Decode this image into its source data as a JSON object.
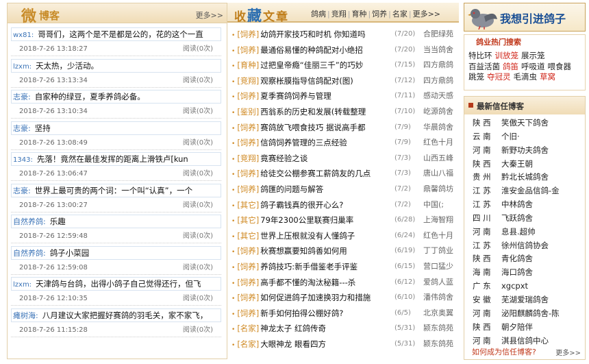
{
  "weibo": {
    "title_big": "微",
    "title_rest": "博客",
    "more": "更多>>",
    "items": [
      {
        "user": "wx81:",
        "text": "哥哥们，这两个是不是都是公的，花的这个一直",
        "time": "2018-7-26 13:18:27",
        "read": "阅读(0次)"
      },
      {
        "user": "lzxm:",
        "text": "天太热，少活动。",
        "time": "2018-7-26 13:13:34",
        "read": "阅读(0次)"
      },
      {
        "user": "志豪:",
        "text": "自家种的绿豆，夏季养鸽必备。",
        "time": "2018-7-26 13:10:34",
        "read": "阅读(0次)"
      },
      {
        "user": "志豪:",
        "text": "坚持",
        "time": "2018-7-26 13:08:49",
        "read": "阅读(0次)"
      },
      {
        "user": "1343:",
        "text": "先落！竟然在最佳发挥的距离上滑铁卢[kun",
        "time": "2018-7-26 13:06:47",
        "read": "阅读(0次)"
      },
      {
        "user": "志豪:",
        "text": "世界上最可贵的两个词：一个叫“认真”，一个",
        "time": "2018-7-26 13:00:27",
        "read": "阅读(0次)"
      },
      {
        "user": "自然养鸽:",
        "text": "乐趣",
        "time": "2018-7-26 12:59:48",
        "read": "阅读(0次)"
      },
      {
        "user": "自然养鸽:",
        "text": "鸽子小菜园",
        "time": "2018-7-26 12:59:08",
        "read": "阅读(0次)"
      },
      {
        "user": "lzxm:",
        "text": "天津鸽与台鸽，出得小鸽子自己觉得还行，但飞",
        "time": "2018-7-26 12:10:35",
        "read": "阅读(0次)"
      },
      {
        "user": "瘫树海:",
        "text": "八月建议大家把握好赛鸽的羽毛关，家不家飞，",
        "time": "2018-7-26 11:15:28",
        "read": "阅读(0次)"
      }
    ]
  },
  "collect": {
    "title_a": "收",
    "title_b": "藏",
    "title_c": "文章",
    "tabs": [
      "鸽病",
      "竞翔",
      "育种",
      "饲养",
      "名家",
      "更多>>"
    ],
    "items": [
      {
        "cat": "[饲养]",
        "title": "幼鸽开家技巧和时机 你知道吗",
        "date": "(7/20)",
        "src": "合肥绿苑"
      },
      {
        "cat": "[饲养]",
        "title": "最通俗易懂的种鸽配对小绝招",
        "date": "(7/20)",
        "src": "当当鸽舍"
      },
      {
        "cat": "[育种]",
        "title": "过把皇帝瘾“佳丽三千”的巧妙",
        "date": "(7/15)",
        "src": "四方鼎鸽"
      },
      {
        "cat": "[竞翔]",
        "title": "观察枨膜指导信鸽配对(图)",
        "date": "(7/12)",
        "src": "四方鼎鸽"
      },
      {
        "cat": "[饲养]",
        "title": "夏季赛鸽饲养与管理",
        "date": "(7/11)",
        "src": "感动天感"
      },
      {
        "cat": "[鉴别]",
        "title": "西翁系的历史和发展(转载整理",
        "date": "(7/10)",
        "src": "屹源鸽舍"
      },
      {
        "cat": "[饲养]",
        "title": "赛鸽放飞喂食技巧 据说高手都",
        "date": "(7/9)",
        "src": "华晨鸽舍"
      },
      {
        "cat": "[饲养]",
        "title": "信鸽饲养管理的三点经验",
        "date": "(7/9)",
        "src": "红色十月"
      },
      {
        "cat": "[竞翔]",
        "title": "竟赛经验之谈",
        "date": "(7/3)",
        "src": "山西五峰"
      },
      {
        "cat": "[饲养]",
        "title": "给徒交公棚参赛工薪鸽友的几点",
        "date": "(7/3)",
        "src": "唐山八福"
      },
      {
        "cat": "[饲养]",
        "title": "鸽匯的问题与解答",
        "date": "(7/2)",
        "src": "鼎馨鸽坊"
      },
      {
        "cat": "[其它]",
        "title": "鸽子霸钱真的很开心么?",
        "date": "(7/2)",
        "src": "中国(;"
      },
      {
        "cat": "[其它]",
        "title": "79年2300公里联赛归巢率",
        "date": "(6/28)",
        "src": "上海智翔"
      },
      {
        "cat": "[其它]",
        "title": "世界上压根就没有人懂鸽子",
        "date": "(6/24)",
        "src": "红色十月"
      },
      {
        "cat": "[饲养]",
        "title": "秋赛想赢要知鸽善如何用",
        "date": "(6/19)",
        "src": "丁丁鸽业"
      },
      {
        "cat": "[饲养]",
        "title": "养鸽技巧:新手借鉴老手评鉴",
        "date": "(6/15)",
        "src": "营口猛少"
      },
      {
        "cat": "[饲养]",
        "title": "高手都不懂的淘汰秘籍---杀",
        "date": "(6/12)",
        "src": "爱鸽人蓝"
      },
      {
        "cat": "[饲养]",
        "title": "如何促进鸽子加速换羽力和措施",
        "date": "(6/10)",
        "src": "潘伟鸽舍"
      },
      {
        "cat": "[饲养]",
        "title": "新手如何拍得公棚好鸽?",
        "date": "(6/5)",
        "src": "北京奥翼"
      },
      {
        "cat": "[名家]",
        "title": "神龙太子 红鸽传奇",
        "date": "(5/31)",
        "src": "颍东鸽苑"
      },
      {
        "cat": "[名家]",
        "title": "大眼神龙 眼看四方",
        "date": "(5/31)",
        "src": "颍东鸽苑"
      }
    ]
  },
  "banner": {
    "text": "我想引进鸽子"
  },
  "hot": {
    "title": "鸽业热门搜索",
    "keywords": [
      {
        "text": "特比环",
        "red": false
      },
      {
        "text": "训放笼",
        "red": true
      },
      {
        "text": "展示笼",
        "red": false
      },
      {
        "text": "百益活菌",
        "red": false
      },
      {
        "text": "鸽笛",
        "red": true
      },
      {
        "text": "呼吸道",
        "red": false
      },
      {
        "text": "喂食器",
        "red": false
      },
      {
        "text": "跳笼",
        "red": false
      },
      {
        "text": "夺冠灵",
        "red": true
      },
      {
        "text": "毛滴虫",
        "red": false
      },
      {
        "text": "草窝",
        "red": true
      }
    ]
  },
  "trust": {
    "title": "最新信任博客",
    "items": [
      {
        "prov": "陕 西",
        "name": "笑傲天下鸽舍"
      },
      {
        "prov": "云 南",
        "name": "个旧·"
      },
      {
        "prov": "河 南",
        "name": "新野功夫鸽舍"
      },
      {
        "prov": "陕 西",
        "name": "大秦王朝"
      },
      {
        "prov": "贵 州",
        "name": "黔北长城鸽舍"
      },
      {
        "prov": "江 苏",
        "name": "淮安金品信鸽-金"
      },
      {
        "prov": "江 苏",
        "name": "中林鸽舍"
      },
      {
        "prov": "四 川",
        "name": "飞跃鸽舍"
      },
      {
        "prov": "河 南",
        "name": "息县.超帅"
      },
      {
        "prov": "江 苏",
        "name": "徐州信鸽协会"
      },
      {
        "prov": "陕 西",
        "name": "青化鸽舍"
      },
      {
        "prov": "海 南",
        "name": "海口鸽舍"
      },
      {
        "prov": "广 东",
        "name": "xgcpxt"
      },
      {
        "prov": "安 徽",
        "name": "芜湖爱瑞鸽舍"
      },
      {
        "prov": "河 南",
        "name": "泌阳麒麟鸽舍-陈"
      },
      {
        "prov": "陕 西",
        "name": "朝夕陪伴"
      },
      {
        "prov": "河 南",
        "name": "淇县信鸽中心"
      }
    ],
    "footer": "如何成为信任博客?",
    "more": "更多>>"
  },
  "colors": {
    "accent": "#c88c2a",
    "link_blue": "#3a73b7",
    "red": "#d0261a"
  }
}
